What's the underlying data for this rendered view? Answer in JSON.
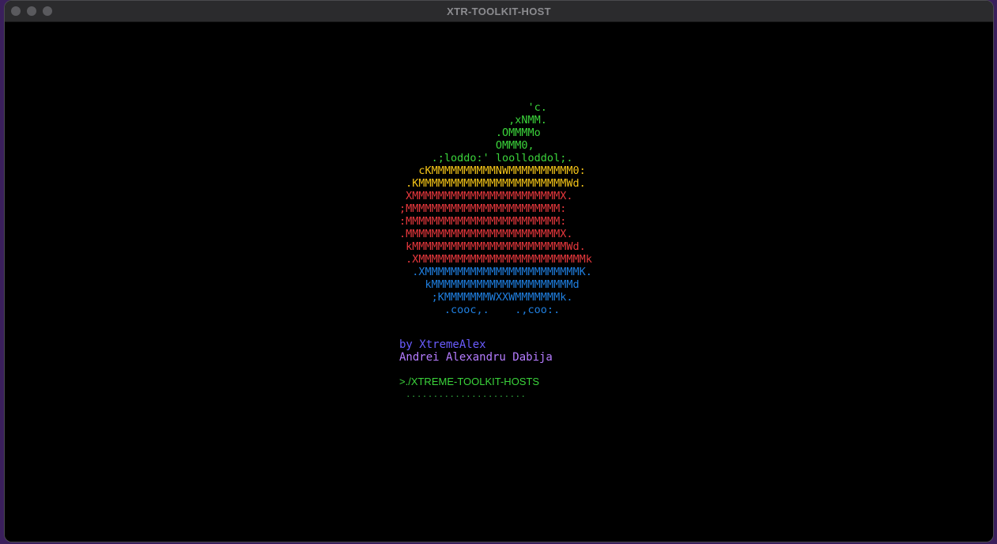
{
  "window": {
    "title": "XTR-TOOLKIT-HOST"
  },
  "colors": {
    "green": "#3bd43b",
    "yellow": "#f5c518",
    "red": "#e8383d",
    "blue": "#1f7fe0",
    "purple_dark": "#6a5cff",
    "purple_light": "#b57cff",
    "cmd_green": "#3bd43b",
    "dots_green": "#2f9e3a"
  },
  "logo": {
    "lines": [
      {
        "text": "                    'c.",
        "color": "green"
      },
      {
        "text": "                 ,xNMM.",
        "color": "green"
      },
      {
        "text": "               .OMMMMo",
        "color": "green"
      },
      {
        "text": "               OMMM0,",
        "color": "green"
      },
      {
        "text": "     .;loddo:' loolloddol;.",
        "color": "green"
      },
      {
        "text": "   cKMMMMMMMMMMNWMMMMMMMMMM0:",
        "color": "yellow"
      },
      {
        "text": " .KMMMMMMMMMMMMMMMMMMMMMMMWd.",
        "color": "yellow"
      },
      {
        "text": " XMMMMMMMMMMMMMMMMMMMMMMMX.",
        "color": "red"
      },
      {
        "text": ";MMMMMMMMMMMMMMMMMMMMMMMM:",
        "color": "red"
      },
      {
        "text": ":MMMMMMMMMMMMMMMMMMMMMMMM:",
        "color": "red"
      },
      {
        "text": ".MMMMMMMMMMMMMMMMMMMMMMMMX.",
        "color": "red"
      },
      {
        "text": " kMMMMMMMMMMMMMMMMMMMMMMMMWd.",
        "color": "red"
      },
      {
        "text": " .XMMMMMMMMMMMMMMMMMMMMMMMMMMk",
        "color": "red"
      },
      {
        "text": "  .XMMMMMMMMMMMMMMMMMMMMMMMMK.",
        "color": "blue"
      },
      {
        "text": "    kMMMMMMMMMMMMMMMMMMMMMMd",
        "color": "blue"
      },
      {
        "text": "     ;KMMMMMMMWXXWMMMMMMMk.",
        "color": "blue"
      },
      {
        "text": "       .cooc,.    .,coo:.",
        "color": "blue"
      }
    ]
  },
  "credits": {
    "by_line": "by XtremeAlex",
    "name_line": "Andrei Alexandru Dabija"
  },
  "terminal": {
    "command": ">./XTREME-TOOLKIT-HOSTS",
    "progress": "......................"
  }
}
